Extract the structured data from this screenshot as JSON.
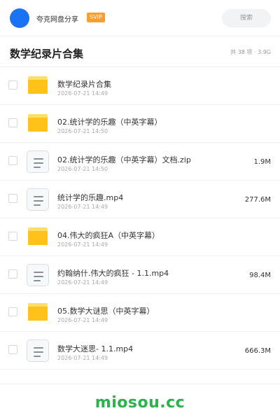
{
  "header": {
    "username": "夸克网盘分享",
    "badge": "SVIP",
    "search_placeholder": "搜索"
  },
  "title": {
    "text": "数学纪录片合集",
    "summary": "共 38 项 · 3.9G"
  },
  "files": [
    {
      "type": "folder",
      "name": "数学纪录片合集",
      "date": "2026-07-21 14:49",
      "size": ""
    },
    {
      "type": "folder",
      "name": "02.统计学的乐趣（中英字幕）",
      "date": "2026-07-21 14:50",
      "size": ""
    },
    {
      "type": "doc",
      "name": "02.统计学的乐趣（中英字幕）文档.zip",
      "date": "2026-07-21 14:50",
      "size": "1.9M"
    },
    {
      "type": "doc",
      "name": "统计学的乐趣.mp4",
      "date": "2026-07-21 14:49",
      "size": "277.6M"
    },
    {
      "type": "folder",
      "name": "04.伟大的疯狂A（中英字幕）",
      "date": "2026-07-21 14:49",
      "size": ""
    },
    {
      "type": "doc",
      "name": "约翰纳什.伟大的疯狂 - 1.1.mp4",
      "date": "2026-07-21 14:49",
      "size": "98.4M"
    },
    {
      "type": "folder",
      "name": "05.数学大谜思（中英字幕）",
      "date": "2026-07-21 14:49",
      "size": ""
    },
    {
      "type": "doc",
      "name": "数学大迷思- 1.1.mp4",
      "date": "2026-07-21 14:49",
      "size": "666.3M"
    }
  ],
  "icons": {
    "folder": "folder-icon",
    "doc": "document-icon"
  },
  "colors": {
    "avatar": "#1a73f5",
    "badge": "#ff9d2e",
    "folder": "#ffc21a",
    "watermark": "#2bb24c"
  },
  "footer": {
    "watermark": "miosou.cc"
  }
}
